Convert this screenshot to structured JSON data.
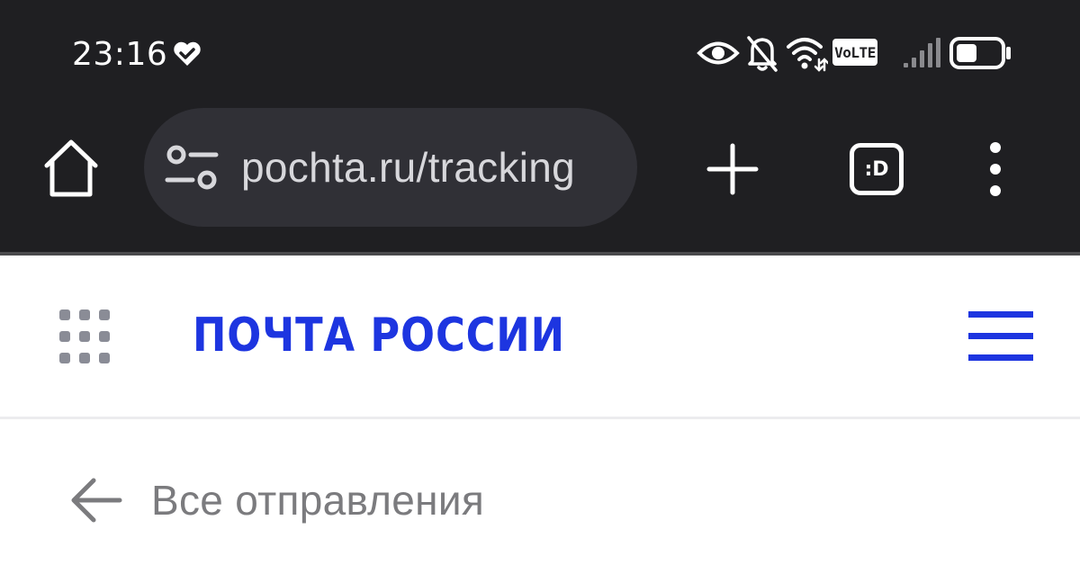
{
  "status_bar": {
    "time": "23:16",
    "network_badge": "VoLTE",
    "icons": [
      "heart-icon",
      "eye-icon",
      "bell-off-icon",
      "wifi-icon",
      "signal-icon",
      "battery-icon"
    ]
  },
  "browser": {
    "url": "pochta.ru/tracking",
    "tabs_label": ":D",
    "icons": [
      "home-icon",
      "site-settings-icon",
      "plus-icon",
      "more-vert-icon"
    ]
  },
  "site_header": {
    "logo_text": "ПОЧТА РОССИИ",
    "icons": [
      "apps-grid-icon",
      "hamburger-menu-icon"
    ]
  },
  "navigation": {
    "back_label": "Все отправления",
    "icons": [
      "arrow-left-icon"
    ]
  },
  "colors": {
    "toolbar_bg": "#1f1f22",
    "url_bar_bg": "#303036",
    "brand_blue": "#1d35e0",
    "muted_text": "#7b7b7e"
  }
}
